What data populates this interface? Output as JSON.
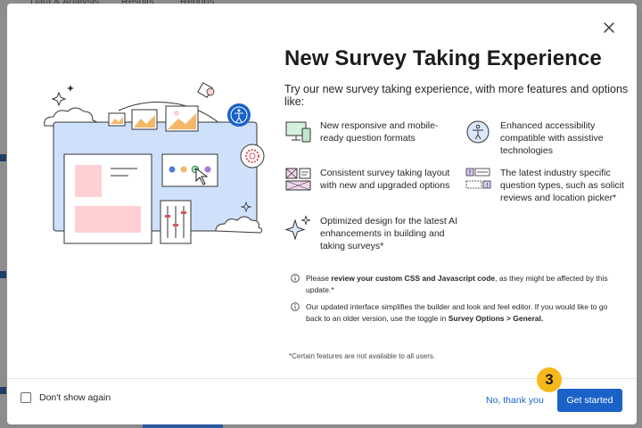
{
  "background": {
    "nav_items": [
      "Data & Analysis",
      "Results",
      "Reports"
    ]
  },
  "modal": {
    "title": "New Survey Taking Experience",
    "subtitle": "Try our new survey taking experience, with more features and options like:",
    "features": [
      {
        "icon": "responsive-devices-icon",
        "text": "New responsive and mobile-ready question formats"
      },
      {
        "icon": "accessibility-icon",
        "text": "Enhanced accessibility compatible with assistive technologies"
      },
      {
        "icon": "layout-icon",
        "text": "Consistent survey taking layout with new and upgraded options"
      },
      {
        "icon": "question-types-icon",
        "text": "The latest industry specific question types, such as solicit reviews and location picker*"
      },
      {
        "icon": "ai-sparkle-icon",
        "text": "Optimized design for the latest AI enhancements in building and taking surveys*"
      }
    ],
    "note1": {
      "pre": "Please ",
      "bold": "review your custom CSS and Javascript code",
      "post": ", as they might be affected by this update.*"
    },
    "note2": {
      "pre": "Our updated interface simplifies the builder and look and feel editor. If you would like to go back to an older version, use the toggle in ",
      "bold": "Survey Options > General."
    },
    "footnote": "*Certain features are not available to all users.",
    "dont_show_label": "Don't show again",
    "no_thanks_label": "No, thank you",
    "get_started_label": "Get started",
    "step_badge": "3"
  },
  "colors": {
    "primary": "#1a62c7",
    "badge": "#f6b81c",
    "illustration_blue": "#cfe0fb",
    "illustration_pink": "#ffd0d3"
  }
}
